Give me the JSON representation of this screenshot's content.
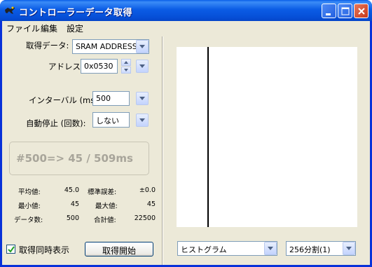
{
  "window": {
    "title": "コントローラーデータ取得"
  },
  "menu": {
    "items": [
      "ファイル",
      "編集",
      "設定"
    ]
  },
  "controls": {
    "acquire_data_label": "取得データ:",
    "acquire_data_value": "SRAM ADDRESS",
    "address_label": "アドレス:",
    "address_value": "0x0530",
    "interval_label": "インターバル (ms):",
    "interval_value": "500",
    "autostop_label": "自動停止 (回数):",
    "autostop_value": "しない"
  },
  "status": {
    "text": "#500=> 45 / 509ms"
  },
  "stats": {
    "mean_label": "平均値:",
    "mean_value": "45.0",
    "stderr_label": "標準誤差:",
    "stderr_value": "±0.0",
    "min_label": "最小値:",
    "min_value": "45",
    "max_label": "最大値:",
    "max_value": "45",
    "count_label": "データ数:",
    "count_value": "500",
    "sum_label": "合計値:",
    "sum_value": "22500"
  },
  "footer": {
    "show_on_acquire_label": "取得同時表示",
    "show_on_acquire_checked": true,
    "start_button": "取得開始"
  },
  "graph": {
    "mode_value": "ヒストグラム",
    "division_value": "256分割(1)"
  },
  "colors": {
    "titlebar": "#0a5fe8",
    "face": "#ece9d8"
  }
}
